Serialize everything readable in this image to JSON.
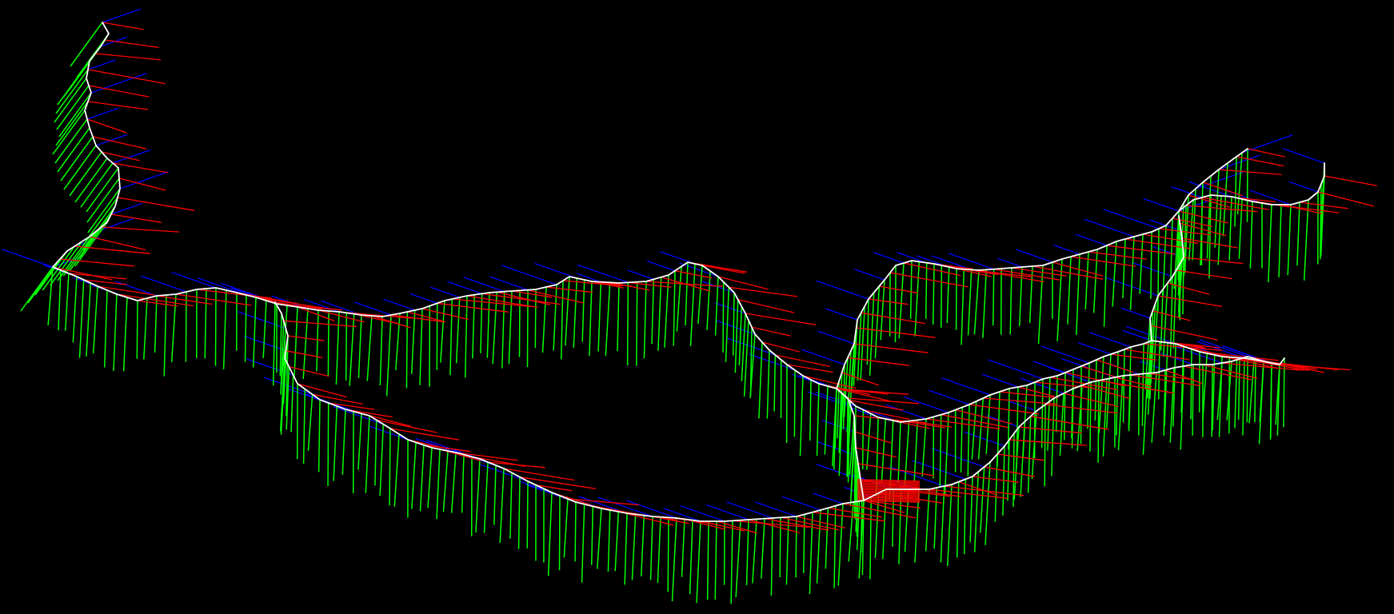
{
  "scene": {
    "background": "#000000",
    "trajectory_color": "#ffffff",
    "axis_colors": {
      "x_axis": "#ff0000",
      "y_axis": "#00ff00",
      "z_axis": "#0000ff"
    },
    "icons": [
      "pose-frame-axes",
      "trajectory-path"
    ]
  }
}
